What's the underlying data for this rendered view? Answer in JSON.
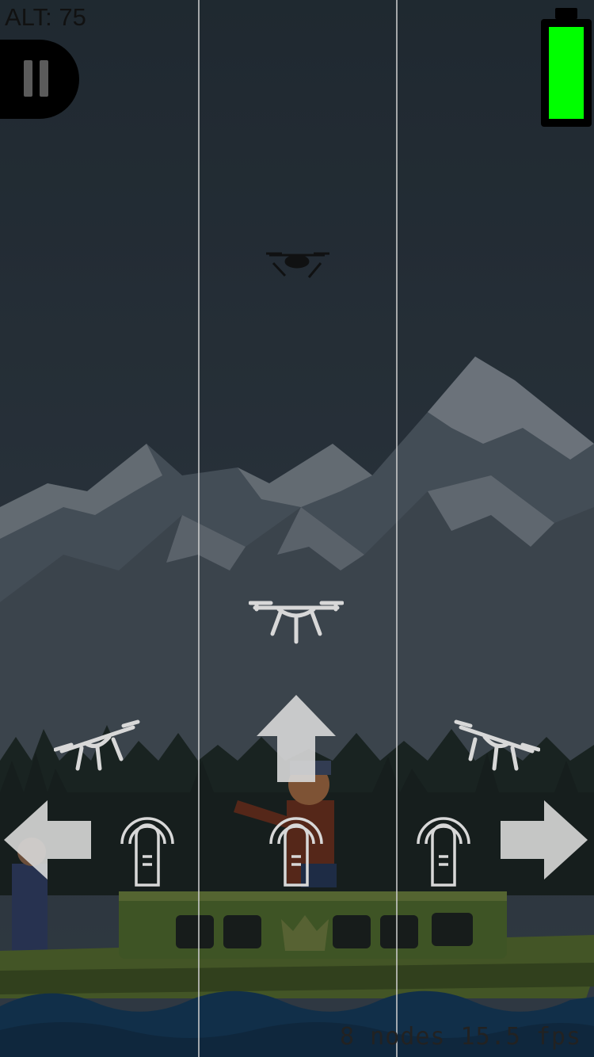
{
  "hud": {
    "altitude_text": "ALT: 75",
    "battery_level": 1.0,
    "battery_color": "#00ff00",
    "stats_text": "8 nodes 15.5 fps"
  },
  "controls": {
    "left_zone": {
      "icon": "arrow-left-icon",
      "gesture": "tap-finger-icon",
      "drone": "drone-tilt-left-icon"
    },
    "center_zone": {
      "icon": "arrow-up-icon",
      "gesture": "tap-finger-icon",
      "drone": "drone-level-icon"
    },
    "right_zone": {
      "icon": "arrow-right-icon",
      "gesture": "tap-finger-icon",
      "drone": "drone-tilt-right-icon"
    }
  },
  "colors": {
    "sky": "#2f3a46",
    "mountain": "#5a6470",
    "snow": "#8a929b",
    "forest": "#1f2a26",
    "water": "#123a5c",
    "boat": "#4e6a2a",
    "overlay_icon": "#d8d8d8"
  }
}
